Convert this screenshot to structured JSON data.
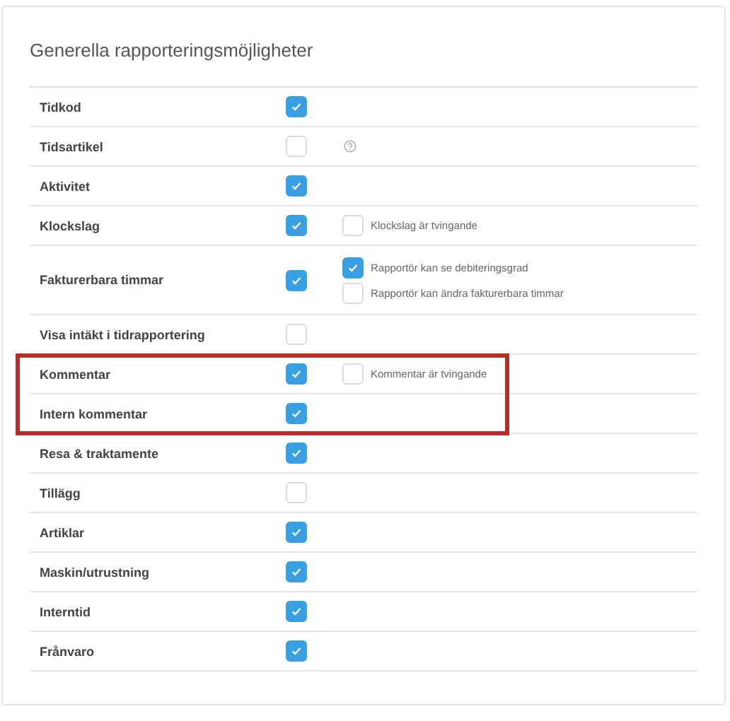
{
  "title": "Generella rapporteringsmöjligheter",
  "rows": [
    {
      "label": "Tidkod",
      "checked": true,
      "help": false,
      "highlighted": false,
      "options": []
    },
    {
      "label": "Tidsartikel",
      "checked": false,
      "help": true,
      "highlighted": false,
      "options": []
    },
    {
      "label": "Aktivitet",
      "checked": true,
      "help": false,
      "highlighted": false,
      "options": []
    },
    {
      "label": "Klockslag",
      "checked": true,
      "help": false,
      "highlighted": false,
      "options": [
        {
          "label": "Klockslag är tvingande",
          "checked": false
        }
      ]
    },
    {
      "label": "Fakturerbara timmar",
      "checked": true,
      "help": false,
      "highlighted": false,
      "options": [
        {
          "label": "Rapportör kan se debiteringsgrad",
          "checked": true
        },
        {
          "label": "Rapportör kan ändra fakturerbara timmar",
          "checked": false
        }
      ]
    },
    {
      "label": "Visa intäkt i tidrapportering",
      "checked": false,
      "help": false,
      "highlighted": false,
      "options": []
    },
    {
      "label": "Kommentar",
      "checked": true,
      "help": false,
      "highlighted": true,
      "options": [
        {
          "label": "Kommentar är tvingande",
          "checked": false
        }
      ]
    },
    {
      "label": "Intern kommentar",
      "checked": true,
      "help": false,
      "highlighted": true,
      "options": []
    },
    {
      "label": "Resa & traktamente",
      "checked": true,
      "help": false,
      "highlighted": false,
      "options": []
    },
    {
      "label": "Tillägg",
      "checked": false,
      "help": false,
      "highlighted": false,
      "options": []
    },
    {
      "label": "Artiklar",
      "checked": true,
      "help": false,
      "highlighted": false,
      "options": []
    },
    {
      "label": "Maskin/utrustning",
      "checked": true,
      "help": false,
      "highlighted": false,
      "options": []
    },
    {
      "label": "Interntid",
      "checked": true,
      "help": false,
      "highlighted": false,
      "options": []
    },
    {
      "label": "Frånvaro",
      "checked": true,
      "help": false,
      "highlighted": false,
      "options": []
    }
  ]
}
